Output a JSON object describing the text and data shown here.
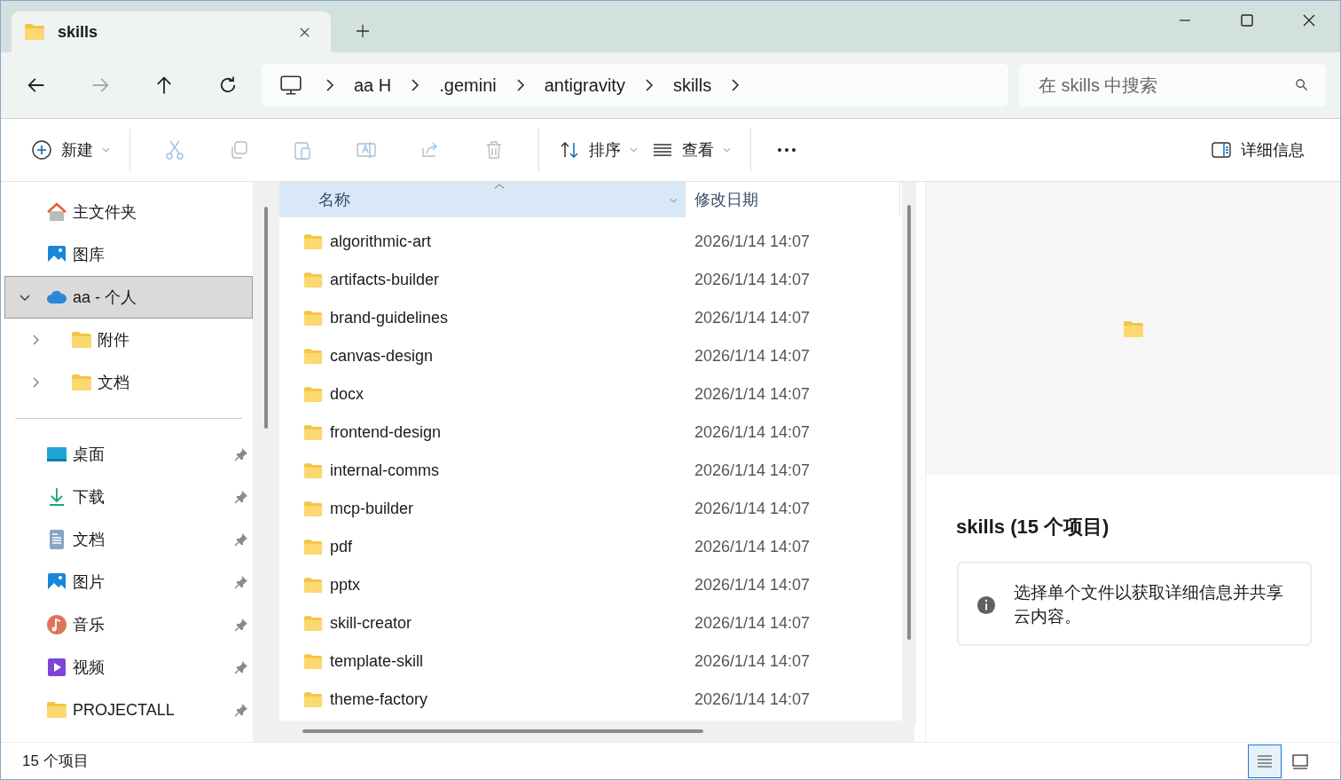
{
  "tabs": [
    {
      "label": "skills",
      "selected": true
    }
  ],
  "nav": {
    "crumbs": [
      "aa H",
      ".gemini",
      "antigravity",
      "skills"
    ],
    "search": {
      "placeholder": "在 skills 中搜索"
    }
  },
  "toolbar": {
    "new": "新建",
    "sort": "排序",
    "view": "查看",
    "details": "详细信息"
  },
  "sidebar": {
    "items": [
      {
        "label": "主文件夹",
        "selected": false
      },
      {
        "label": "图库",
        "selected": false
      },
      {
        "label": "aa - 个人",
        "selected": true,
        "expanded": true,
        "children": [
          {
            "label": "附件",
            "expanded": false
          },
          {
            "label": "文档",
            "expanded": false
          }
        ]
      }
    ],
    "quick_access": [
      {
        "label": "桌面",
        "pinned": true
      },
      {
        "label": "下载",
        "pinned": true
      },
      {
        "label": "文档",
        "pinned": true
      },
      {
        "label": "图片",
        "pinned": true
      },
      {
        "label": "音乐",
        "pinned": true
      },
      {
        "label": "视频",
        "pinned": true
      },
      {
        "label": "PROJECTALL",
        "pinned": true
      }
    ]
  },
  "table": {
    "columns": [
      {
        "label": "名称",
        "sorted": true
      },
      {
        "label": "修改日期",
        "sorted": false
      }
    ],
    "rows": [
      {
        "name": "algorithmic-art",
        "modified": "2026/1/14 14:07"
      },
      {
        "name": "artifacts-builder",
        "modified": "2026/1/14 14:07"
      },
      {
        "name": "brand-guidelines",
        "modified": "2026/1/14 14:07"
      },
      {
        "name": "canvas-design",
        "modified": "2026/1/14 14:07"
      },
      {
        "name": "docx",
        "modified": "2026/1/14 14:07"
      },
      {
        "name": "frontend-design",
        "modified": "2026/1/14 14:07"
      },
      {
        "name": "internal-comms",
        "modified": "2026/1/14 14:07"
      },
      {
        "name": "mcp-builder",
        "modified": "2026/1/14 14:07"
      },
      {
        "name": "pdf",
        "modified": "2026/1/14 14:07"
      },
      {
        "name": "pptx",
        "modified": "2026/1/14 14:07"
      },
      {
        "name": "skill-creator",
        "modified": "2026/1/14 14:07"
      },
      {
        "name": "template-skill",
        "modified": "2026/1/14 14:07"
      },
      {
        "name": "theme-factory",
        "modified": "2026/1/14 14:07"
      }
    ]
  },
  "details_pane": {
    "title": "skills (15 个项目)",
    "info": "选择单个文件以获取详细信息并共享云内容。"
  },
  "status_bar": {
    "count": "15 个项目",
    "views": [
      {
        "kind": "details",
        "selected": true
      },
      {
        "kind": "tiles",
        "selected": false
      }
    ]
  }
}
